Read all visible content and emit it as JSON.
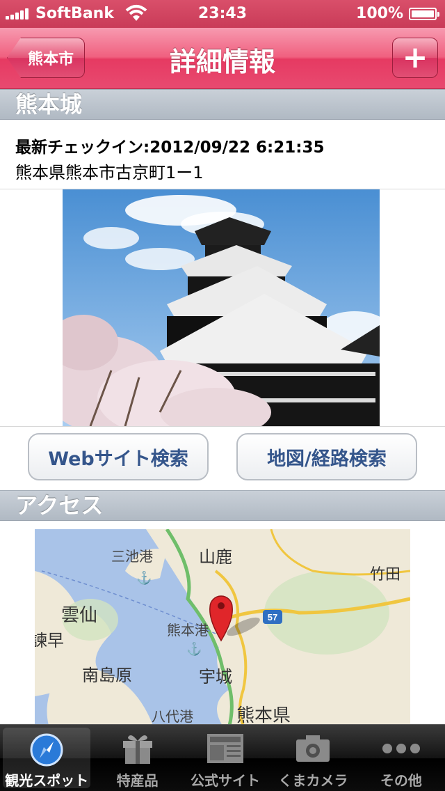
{
  "status_bar": {
    "carrier": "SoftBank",
    "time": "23:43",
    "battery": "100%",
    "battery_level": 1.0
  },
  "nav": {
    "back_label": "熊本市",
    "title": "詳細情報",
    "add_label": "+"
  },
  "spot": {
    "name": "熊本城",
    "checkin": "最新チェックイン:2012/09/22 6:21:35",
    "address": "熊本県熊本市古京町1ー1"
  },
  "buttons": {
    "web_search": "Webサイト検索",
    "map_search": "地図/経路検索"
  },
  "access": {
    "header": "アクセス",
    "map_labels": {
      "miike_port": "三池港",
      "yamaga": "山鹿",
      "taketa": "竹田",
      "unzen": "雲仙",
      "kumamoto_port": "熊本港",
      "route_57": "57",
      "isahaya_partial": "諫早",
      "minamishimabara": "南島原",
      "uto": "宇城",
      "yatsushiro_port": "八代港",
      "kumamoto_pref": "熊本県"
    }
  },
  "tabs": [
    {
      "label": "観光スポット",
      "icon": "compass-icon",
      "active": true
    },
    {
      "label": "特産品",
      "icon": "gift-icon",
      "active": false
    },
    {
      "label": "公式サイト",
      "icon": "newspaper-icon",
      "active": false
    },
    {
      "label": "くまカメラ",
      "icon": "camera-icon",
      "active": false
    },
    {
      "label": "その他",
      "icon": "more-icon",
      "active": false
    }
  ],
  "colors": {
    "nav_pink": "#e84a70",
    "status_bar": "#c93b58",
    "button_text": "#34558b",
    "section_header": "#b0b9c3"
  }
}
